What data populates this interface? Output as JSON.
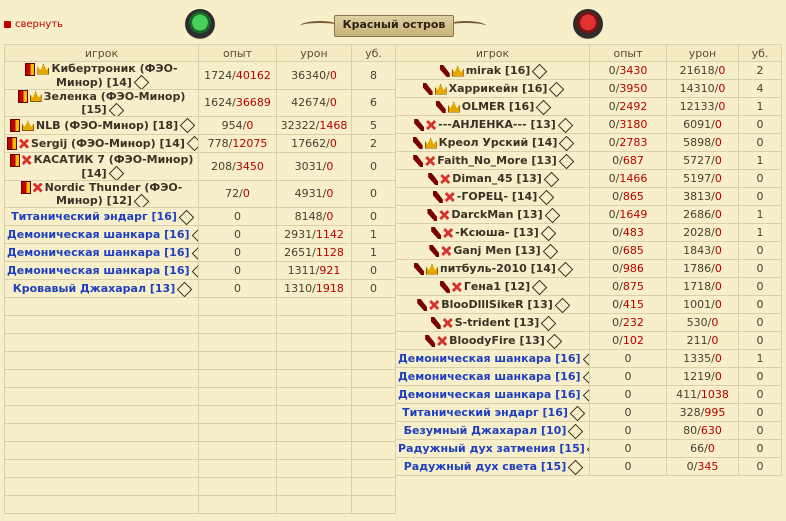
{
  "header": {
    "collapse_label": "свернуть",
    "title": "Красный остров",
    "left_emblem_icon": "green-orb-icon",
    "right_emblem_icon": "red-orb-icon"
  },
  "columns": {
    "player": "игрок",
    "exp": "опыт",
    "damage": "урон",
    "kills": "уб."
  },
  "left_team": [
    {
      "name": "Кибертроник (ФЭО-Минор) [14]",
      "exp": "1724/",
      "exp_hi": "40162",
      "dmg": "36340/",
      "dmg_hi": "0",
      "kills": "8",
      "icons": [
        "flag",
        "crown"
      ],
      "two_line": true,
      "bot": false
    },
    {
      "name": "Зеленка (ФЭО-Минор) [15]",
      "exp": "1624/",
      "exp_hi": "36689",
      "dmg": "42674/",
      "dmg_hi": "0",
      "kills": "6",
      "icons": [
        "flag",
        "crown"
      ],
      "two_line": true,
      "bot": false
    },
    {
      "name": "NLB (ФЭО-Минор) [18]",
      "exp": "954/",
      "exp_hi": "0",
      "dmg": "32322/",
      "dmg_hi": "1468",
      "kills": "5",
      "icons": [
        "flag",
        "crown"
      ],
      "two_line": false,
      "bot": false
    },
    {
      "name": "Sergij (ФЭО-Минор) [14]",
      "exp": "778/",
      "exp_hi": "12075",
      "dmg": "17662/",
      "dmg_hi": "0",
      "kills": "2",
      "icons": [
        "flag",
        "cross"
      ],
      "two_line": false,
      "bot": false
    },
    {
      "name": "КАСАТИК 7 (ФЭО-Минор) [14]",
      "exp": "208/",
      "exp_hi": "3450",
      "dmg": "3031/",
      "dmg_hi": "0",
      "kills": "0",
      "icons": [
        "flag",
        "cross"
      ],
      "two_line": true,
      "bot": false
    },
    {
      "name": "Nordic Thunder (ФЭО-Минор) [12]",
      "exp": "72/",
      "exp_hi": "0",
      "dmg": "4931/",
      "dmg_hi": "0",
      "kills": "0",
      "icons": [
        "flag",
        "cross"
      ],
      "two_line": true,
      "bot": false
    },
    {
      "name": "Титанический эндарг [16]",
      "exp": "0",
      "exp_hi": "",
      "dmg": "8148/",
      "dmg_hi": "0",
      "kills": "0",
      "icons": [],
      "two_line": false,
      "bot": true
    },
    {
      "name": "Демоническая шанкара [16]",
      "exp": "0",
      "exp_hi": "",
      "dmg": "2931/",
      "dmg_hi": "1142",
      "kills": "1",
      "icons": [],
      "two_line": false,
      "bot": true
    },
    {
      "name": "Демоническая шанкара [16]",
      "exp": "0",
      "exp_hi": "",
      "dmg": "2651/",
      "dmg_hi": "1128",
      "kills": "1",
      "icons": [],
      "two_line": false,
      "bot": true
    },
    {
      "name": "Демоническая шанкара [16]",
      "exp": "0",
      "exp_hi": "",
      "dmg": "1311/",
      "dmg_hi": "921",
      "kills": "0",
      "icons": [],
      "two_line": false,
      "bot": true
    },
    {
      "name": "Кровавый Джахарал [13]",
      "exp": "0",
      "exp_hi": "",
      "dmg": "1310/",
      "dmg_hi": "1918",
      "kills": "0",
      "icons": [],
      "two_line": false,
      "bot": true
    }
  ],
  "right_team": [
    {
      "name": "mirak [16]",
      "exp": "0/",
      "exp_hi": "3430",
      "dmg": "21618/",
      "dmg_hi": "0",
      "kills": "2",
      "icons": [
        "sword",
        "crown"
      ],
      "two_line": true,
      "bot": false
    },
    {
      "name": "Харрикейн [16]",
      "exp": "0/",
      "exp_hi": "3950",
      "dmg": "14310/",
      "dmg_hi": "0",
      "kills": "4",
      "icons": [
        "sword",
        "crown"
      ],
      "two_line": true,
      "bot": false
    },
    {
      "name": "OLMER [16]",
      "exp": "0/",
      "exp_hi": "2492",
      "dmg": "12133/",
      "dmg_hi": "0",
      "kills": "1",
      "icons": [
        "sword",
        "crown"
      ],
      "two_line": false,
      "bot": false
    },
    {
      "name": "---АНЛЕНКА--- [13]",
      "exp": "0/",
      "exp_hi": "3180",
      "dmg": "6091/",
      "dmg_hi": "0",
      "kills": "0",
      "icons": [
        "sword",
        "cross"
      ],
      "two_line": false,
      "bot": false
    },
    {
      "name": "Креол Урский [14]",
      "exp": "0/",
      "exp_hi": "2783",
      "dmg": "5898/",
      "dmg_hi": "0",
      "kills": "0",
      "icons": [
        "sword",
        "crown"
      ],
      "two_line": true,
      "bot": false
    },
    {
      "name": "Faith_No_More [13]",
      "exp": "0/",
      "exp_hi": "687",
      "dmg": "5727/",
      "dmg_hi": "0",
      "kills": "1",
      "icons": [
        "sword",
        "cross"
      ],
      "two_line": true,
      "bot": false
    },
    {
      "name": "Diman_45 [13]",
      "exp": "0/",
      "exp_hi": "1466",
      "dmg": "5197/",
      "dmg_hi": "0",
      "kills": "0",
      "icons": [
        "sword",
        "cross"
      ],
      "two_line": false,
      "bot": false
    },
    {
      "name": "-ГОРЕЦ- [14]",
      "exp": "0/",
      "exp_hi": "865",
      "dmg": "3813/",
      "dmg_hi": "0",
      "kills": "0",
      "icons": [
        "sword",
        "cross"
      ],
      "two_line": false,
      "bot": false
    },
    {
      "name": "DarckMan [13]",
      "exp": "0/",
      "exp_hi": "1649",
      "dmg": "2686/",
      "dmg_hi": "0",
      "kills": "1",
      "icons": [
        "sword",
        "cross"
      ],
      "two_line": false,
      "bot": false
    },
    {
      "name": "-Ксюша- [13]",
      "exp": "0/",
      "exp_hi": "483",
      "dmg": "2028/",
      "dmg_hi": "0",
      "kills": "1",
      "icons": [
        "sword",
        "cross"
      ],
      "two_line": false,
      "bot": false
    },
    {
      "name": "Ganj Men [13]",
      "exp": "0/",
      "exp_hi": "685",
      "dmg": "1843/",
      "dmg_hi": "0",
      "kills": "0",
      "icons": [
        "sword",
        "cross"
      ],
      "two_line": false,
      "bot": false
    },
    {
      "name": "питбуль-2010 [14]",
      "exp": "0/",
      "exp_hi": "986",
      "dmg": "1786/",
      "dmg_hi": "0",
      "kills": "0",
      "icons": [
        "sword",
        "crown"
      ],
      "two_line": false,
      "bot": false
    },
    {
      "name": "Гена1 [12]",
      "exp": "0/",
      "exp_hi": "875",
      "dmg": "1718/",
      "dmg_hi": "0",
      "kills": "0",
      "icons": [
        "sword",
        "cross"
      ],
      "two_line": false,
      "bot": false
    },
    {
      "name": "BlooDlllSikeR [13]",
      "exp": "0/",
      "exp_hi": "415",
      "dmg": "1001/",
      "dmg_hi": "0",
      "kills": "0",
      "icons": [
        "sword",
        "cross"
      ],
      "two_line": false,
      "bot": false
    },
    {
      "name": "S-trident [13]",
      "exp": "0/",
      "exp_hi": "232",
      "dmg": "530/",
      "dmg_hi": "0",
      "kills": "0",
      "icons": [
        "sword",
        "cross"
      ],
      "two_line": false,
      "bot": false
    },
    {
      "name": "BloodyFire [13]",
      "exp": "0/",
      "exp_hi": "102",
      "dmg": "211/",
      "dmg_hi": "0",
      "kills": "0",
      "icons": [
        "sword",
        "cross"
      ],
      "two_line": false,
      "bot": false
    },
    {
      "name": "Демоническая шанкара [16]",
      "exp": "0",
      "exp_hi": "",
      "dmg": "1335/",
      "dmg_hi": "0",
      "kills": "1",
      "icons": [],
      "two_line": false,
      "bot": true
    },
    {
      "name": "Демоническая шанкара [16]",
      "exp": "0",
      "exp_hi": "",
      "dmg": "1219/",
      "dmg_hi": "0",
      "kills": "0",
      "icons": [],
      "two_line": false,
      "bot": true
    },
    {
      "name": "Демоническая шанкара [16]",
      "exp": "0",
      "exp_hi": "",
      "dmg": "411/",
      "dmg_hi": "1038",
      "kills": "0",
      "icons": [],
      "two_line": false,
      "bot": true
    },
    {
      "name": "Титанический эндарг [16]",
      "exp": "0",
      "exp_hi": "",
      "dmg": "328/",
      "dmg_hi": "995",
      "kills": "0",
      "icons": [],
      "two_line": false,
      "bot": true
    },
    {
      "name": "Безумный Джахарал [10]",
      "exp": "0",
      "exp_hi": "",
      "dmg": "80/",
      "dmg_hi": "630",
      "kills": "0",
      "icons": [],
      "two_line": false,
      "bot": true
    },
    {
      "name": "Радужный дух затмения [15]",
      "exp": "0",
      "exp_hi": "",
      "dmg": "66/",
      "dmg_hi": "0",
      "kills": "0",
      "icons": [],
      "two_line": false,
      "bot": true
    },
    {
      "name": "Радужный дух света [15]",
      "exp": "0",
      "exp_hi": "",
      "dmg": "0/",
      "dmg_hi": "345",
      "kills": "0",
      "icons": [],
      "two_line": false,
      "bot": true
    }
  ]
}
